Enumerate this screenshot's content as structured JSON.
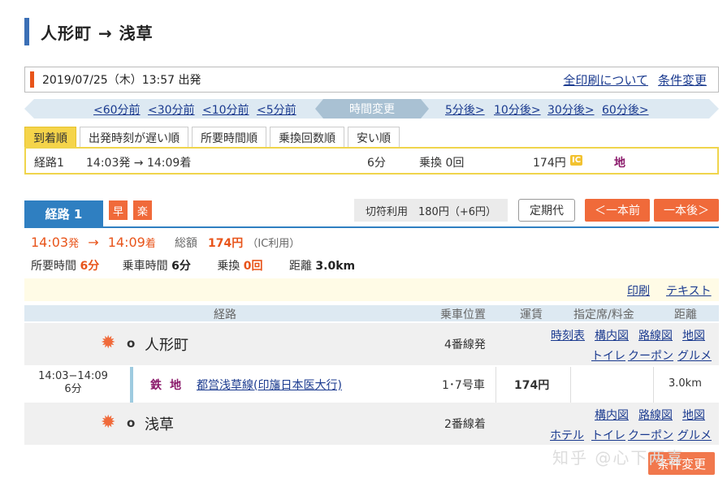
{
  "title": "人形町 → 浅草",
  "condition": {
    "datetime": "2019/07/25（木）13:57 出発",
    "print_all": "全印刷について",
    "change_cond": "条件変更"
  },
  "timenav": {
    "before": [
      "<60分前",
      "<30分前",
      "<10分前",
      "<5分前"
    ],
    "center": "時間変更",
    "after": [
      "5分後>",
      "10分後>",
      "30分後>",
      "60分後>"
    ]
  },
  "sort_tabs": [
    "到着順",
    "出発時刻が遅い順",
    "所要時間順",
    "乗換回数順",
    "安い順"
  ],
  "route_list": {
    "label": "経路1",
    "times": "14:03発 → 14:09着",
    "duration": "6分",
    "transfers": "乗換 0回",
    "fare": "174円",
    "ic": "IC",
    "subway": "地"
  },
  "route_detail": {
    "tab_label": "経路 1",
    "badge_fast": "早",
    "badge_easy": "楽",
    "ticket_fare": "切符利用　180円（+6円）",
    "commuter_pass": "定期代",
    "prev": "＜一本前",
    "next": "一本後＞",
    "depart": "14:03",
    "depart_suffix": "発",
    "arrow": "→",
    "arrive": "14:09",
    "arrive_suffix": "着",
    "total_label": "総額",
    "total": "174円",
    "total_note": "（IC利用）",
    "time_label": "所要時間",
    "time": "6分",
    "ride_label": "乗車時間",
    "ride": "6分",
    "transfer_label": "乗換",
    "transfer": "0回",
    "dist_label": "距離",
    "dist": "3.0km",
    "print": "印刷",
    "text": "テキスト"
  },
  "table_header": {
    "route": "経路",
    "position": "乗車位置",
    "fare": "運賃",
    "reserved": "指定席/料金",
    "distance": "距離"
  },
  "origin": {
    "name": "人形町",
    "mark": "o",
    "platform": "4番線発",
    "links": [
      "時刻表",
      "構内図",
      "路線図",
      "地図",
      "トイレ",
      "クーポン",
      "グルメ"
    ]
  },
  "segment": {
    "time": "14:03−14:09",
    "duration": "6分",
    "icon_a": "鉄",
    "icon_b": "地",
    "line_name": "都営浅草線(印旛日本医大行)",
    "car": "1･7号車",
    "fare": "174円",
    "distance": "3.0km"
  },
  "destination": {
    "name": "浅草",
    "mark": "o",
    "platform": "2番線着",
    "links": [
      "構内図",
      "路線図",
      "地図",
      "ホテル",
      "トイレ",
      "クーポン",
      "グルメ"
    ]
  },
  "watermark": "知乎 @心下两喜",
  "bottom_button": "条件変更",
  "colors": {
    "accent_blue": "#2f7fc1",
    "accent_orange": "#f06a3a",
    "highlight_yellow": "#f5d44a"
  }
}
